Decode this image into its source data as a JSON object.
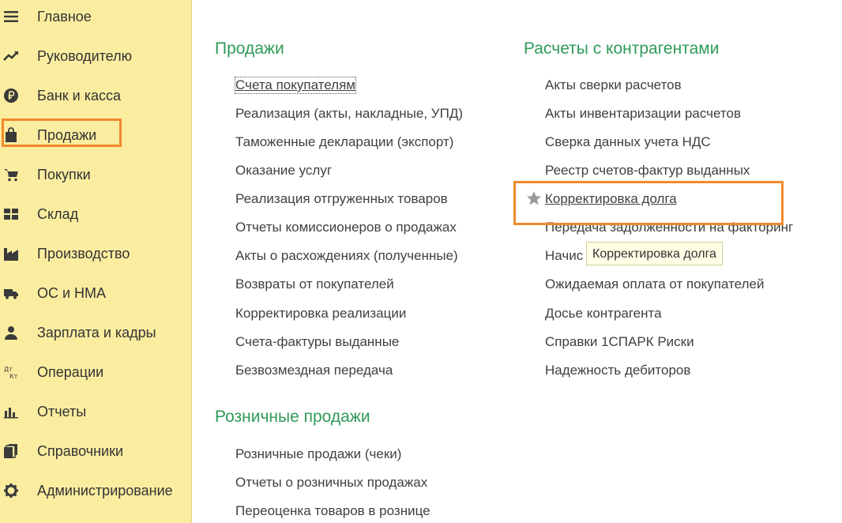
{
  "sidebar": {
    "items": [
      {
        "label": "Главное",
        "icon": "menu-icon"
      },
      {
        "label": "Руководителю",
        "icon": "trend-icon"
      },
      {
        "label": "Банк и касса",
        "icon": "ruble-icon"
      },
      {
        "label": "Продажи",
        "icon": "shopping-bag-icon"
      },
      {
        "label": "Покупки",
        "icon": "cart-icon"
      },
      {
        "label": "Склад",
        "icon": "warehouse-icon"
      },
      {
        "label": "Производство",
        "icon": "factory-icon"
      },
      {
        "label": "ОС и НМА",
        "icon": "truck-icon"
      },
      {
        "label": "Зарплата и кадры",
        "icon": "person-icon"
      },
      {
        "label": "Операции",
        "icon": "debit-credit-icon"
      },
      {
        "label": "Отчеты",
        "icon": "bar-chart-icon"
      },
      {
        "label": "Справочники",
        "icon": "books-icon"
      },
      {
        "label": "Администрирование",
        "icon": "gear-icon"
      }
    ],
    "active_index": 3
  },
  "sections": {
    "sales": {
      "title": "Продажи",
      "links": [
        "Счета покупателям",
        "Реализация (акты, накладные, УПД)",
        "Таможенные декларации (экспорт)",
        "Оказание услуг",
        "Реализация отгруженных товаров",
        "Отчеты комиссионеров о продажах",
        "Акты о расхождениях (полученные)",
        "Возвраты от покупателей",
        "Корректировка реализации",
        "Счета-фактуры выданные",
        "Безвозмездная передача"
      ]
    },
    "retail": {
      "title": "Розничные продажи",
      "links": [
        "Розничные продажи (чеки)",
        "Отчеты о розничных продажах",
        "Переоценка товаров в рознице"
      ]
    },
    "settlements": {
      "title": "Расчеты с контрагентами",
      "links": [
        "Акты сверки расчетов",
        "Акты инвентаризации расчетов",
        "Сверка данных учета НДС",
        "Реестр счетов-фактур выданных",
        "Корректировка долга",
        "Передача задолженности на факторинг",
        "Начис",
        "Ожидаемая оплата от покупателей",
        "Досье контрагента",
        "Справки 1СПАРК Риски",
        "Надежность дебиторов"
      ]
    }
  },
  "tooltip": "Корректировка долга",
  "colors": {
    "sidebar_bg": "#fbeda0",
    "section_title": "#2f9b59",
    "highlight": "#f08a2c",
    "tooltip_bg": "#ffffe6"
  }
}
